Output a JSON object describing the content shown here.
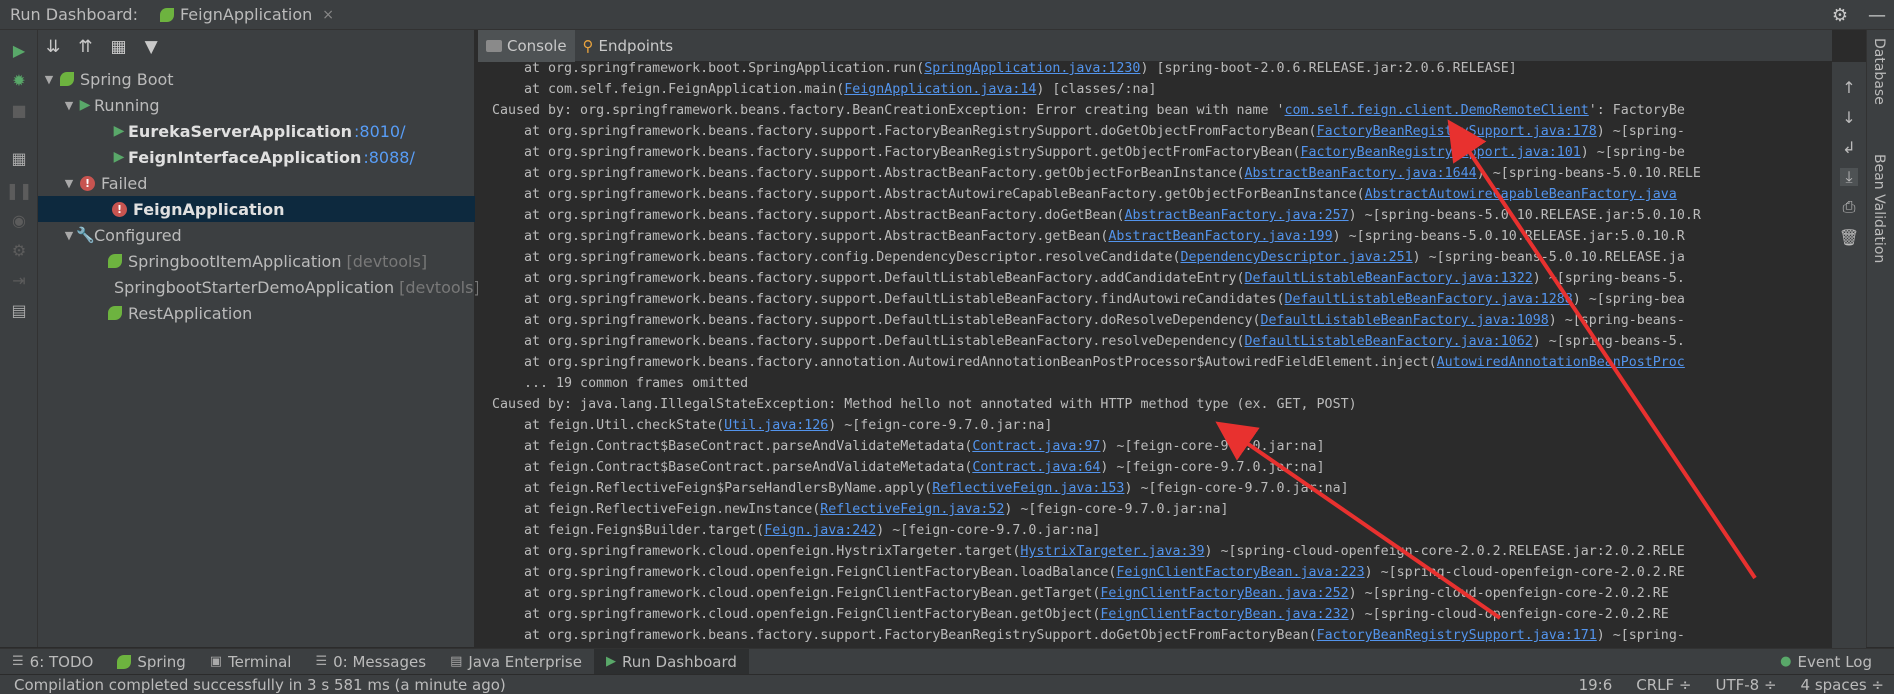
{
  "window": {
    "title": "Run Dashboard:",
    "active_tab": "FeignApplication",
    "tab_close": "×"
  },
  "tree": {
    "spring_boot": "Spring Boot",
    "running": "Running",
    "eureka_name": "EurekaServerApplication",
    "eureka_port": ":8010/",
    "feign_interface_name": "FeignInterfaceApplication",
    "feign_interface_port": ":8088/",
    "failed": "Failed",
    "feign_app": "FeignApplication",
    "configured": "Configured",
    "item_app": "SpringbootItemApplication",
    "item_tag": "[devtools]",
    "starter_app": "SpringbootStarterDemoApplication",
    "starter_tag": "[devtools]",
    "rest_app": "RestApplication"
  },
  "console_tabs": {
    "console": "Console",
    "endpoints": "Endpoints"
  },
  "console_lines": [
    {
      "pre": "    at org.springframework.boot.SpringApplication.run(",
      "link": "SpringApplication.java:1230",
      "post": ") [spring-boot-2.0.6.RELEASE.jar:2.0.6.RELEASE]"
    },
    {
      "pre": "    at com.self.feign.FeignApplication.main(",
      "link": "FeignApplication.java:14",
      "post": ") [classes/:na]"
    },
    {
      "pre": "Caused by: org.springframework.beans.factory.BeanCreationException: Error creating bean with name '",
      "link": "com.self.feign.client.DemoRemoteClient",
      "post": "': FactoryBe"
    },
    {
      "pre": "    at org.springframework.beans.factory.support.FactoryBeanRegistrySupport.doGetObjectFromFactoryBean(",
      "link": "FactoryBeanRegistrySupport.java:178",
      "post": ") ~[spring-"
    },
    {
      "pre": "    at org.springframework.beans.factory.support.FactoryBeanRegistrySupport.getObjectFromFactoryBean(",
      "link": "FactoryBeanRegistrySupport.java:101",
      "post": ") ~[spring-be"
    },
    {
      "pre": "    at org.springframework.beans.factory.support.AbstractBeanFactory.getObjectForBeanInstance(",
      "link": "AbstractBeanFactory.java:1644",
      "post": ") ~[spring-beans-5.0.10.RELE"
    },
    {
      "pre": "    at org.springframework.beans.factory.support.AbstractAutowireCapableBeanFactory.getObjectForBeanInstance(",
      "link": "AbstractAutowireCapableBeanFactory.java",
      "post": ""
    },
    {
      "pre": "    at org.springframework.beans.factory.support.AbstractBeanFactory.doGetBean(",
      "link": "AbstractBeanFactory.java:257",
      "post": ") ~[spring-beans-5.0.10.RELEASE.jar:5.0.10.R"
    },
    {
      "pre": "    at org.springframework.beans.factory.support.AbstractBeanFactory.getBean(",
      "link": "AbstractBeanFactory.java:199",
      "post": ") ~[spring-beans-5.0.10.RELEASE.jar:5.0.10.R"
    },
    {
      "pre": "    at org.springframework.beans.factory.config.DependencyDescriptor.resolveCandidate(",
      "link": "DependencyDescriptor.java:251",
      "post": ") ~[spring-beans-5.0.10.RELEASE.ja"
    },
    {
      "pre": "    at org.springframework.beans.factory.support.DefaultListableBeanFactory.addCandidateEntry(",
      "link": "DefaultListableBeanFactory.java:1322",
      "post": ") ~[spring-beans-5."
    },
    {
      "pre": "    at org.springframework.beans.factory.support.DefaultListableBeanFactory.findAutowireCandidates(",
      "link": "DefaultListableBeanFactory.java:1288",
      "post": ") ~[spring-bea"
    },
    {
      "pre": "    at org.springframework.beans.factory.support.DefaultListableBeanFactory.doResolveDependency(",
      "link": "DefaultListableBeanFactory.java:1098",
      "post": ") ~[spring-beans-"
    },
    {
      "pre": "    at org.springframework.beans.factory.support.DefaultListableBeanFactory.resolveDependency(",
      "link": "DefaultListableBeanFactory.java:1062",
      "post": ") ~[spring-beans-5."
    },
    {
      "pre": "    at org.springframework.beans.factory.annotation.AutowiredAnnotationBeanPostProcessor$AutowiredFieldElement.inject(",
      "link": "AutowiredAnnotationBeanPostProc",
      "post": ""
    },
    {
      "pre": "    ... 19 common frames omitted",
      "link": "",
      "post": ""
    },
    {
      "pre": "Caused by: java.lang.IllegalStateException: Method hello not annotated with HTTP method type (ex. GET, POST)",
      "link": "",
      "post": ""
    },
    {
      "pre": "    at feign.Util.checkState(",
      "link": "Util.java:126",
      "post": ") ~[feign-core-9.7.0.jar:na]"
    },
    {
      "pre": "    at feign.Contract$BaseContract.parseAndValidateMetadata(",
      "link": "Contract.java:97",
      "post": ") ~[feign-core-9.7.0.jar:na]"
    },
    {
      "pre": "    at feign.Contract$BaseContract.parseAndValidateMetadata(",
      "link": "Contract.java:64",
      "post": ") ~[feign-core-9.7.0.jar:na]"
    },
    {
      "pre": "    at feign.ReflectiveFeign$ParseHandlersByName.apply(",
      "link": "ReflectiveFeign.java:153",
      "post": ") ~[feign-core-9.7.0.jar:na]"
    },
    {
      "pre": "    at feign.ReflectiveFeign.newInstance(",
      "link": "ReflectiveFeign.java:52",
      "post": ") ~[feign-core-9.7.0.jar:na]"
    },
    {
      "pre": "    at feign.Feign$Builder.target(",
      "link": "Feign.java:242",
      "post": ") ~[feign-core-9.7.0.jar:na]"
    },
    {
      "pre": "    at org.springframework.cloud.openfeign.HystrixTargeter.target(",
      "link": "HystrixTargeter.java:39",
      "post": ") ~[spring-cloud-openfeign-core-2.0.2.RELEASE.jar:2.0.2.RELE"
    },
    {
      "pre": "    at org.springframework.cloud.openfeign.FeignClientFactoryBean.loadBalance(",
      "link": "FeignClientFactoryBean.java:223",
      "post": ") ~[spring-cloud-openfeign-core-2.0.2.RE"
    },
    {
      "pre": "    at org.springframework.cloud.openfeign.FeignClientFactoryBean.getTarget(",
      "link": "FeignClientFactoryBean.java:252",
      "post": ") ~[spring-cloud-openfeign-core-2.0.2.RE"
    },
    {
      "pre": "    at org.springframework.cloud.openfeign.FeignClientFactoryBean.getObject(",
      "link": "FeignClientFactoryBean.java:232",
      "post": ") ~[spring-cloud-openfeign-core-2.0.2.RE"
    },
    {
      "pre": "    at org.springframework.beans.factory.support.FactoryBeanRegistrySupport.doGetObjectFromFactoryBean(",
      "link": "FactoryBeanRegistrySupport.java:171",
      "post": ") ~[spring-"
    }
  ],
  "right_stripe": {
    "database": "Database",
    "bean_validation": "Bean Validation"
  },
  "bottom_bar": {
    "todo": "6: TODO",
    "spring": "Spring",
    "terminal": "Terminal",
    "messages": "0: Messages",
    "java_enterprise": "Java Enterprise",
    "run_dashboard": "Run Dashboard",
    "event_log": "Event Log"
  },
  "status": {
    "message": "Compilation completed successfully in 3 s 581 ms (a minute ago)",
    "position": "19:6",
    "line_sep": "CRLF ÷",
    "encoding": "UTF-8 ÷",
    "indent": "4 spaces ÷"
  },
  "colors": {
    "background": "#2b2b2b",
    "panel": "#3c3f41",
    "link": "#5394ec",
    "run_green": "#59a869",
    "error_red": "#c75450",
    "arrow_red": "#e8312f"
  },
  "icons": [
    "leaf-icon",
    "play-icon",
    "error-icon",
    "wrench-icon",
    "gear-icon",
    "minimize-icon",
    "console-icon",
    "endpoints-icon"
  ]
}
